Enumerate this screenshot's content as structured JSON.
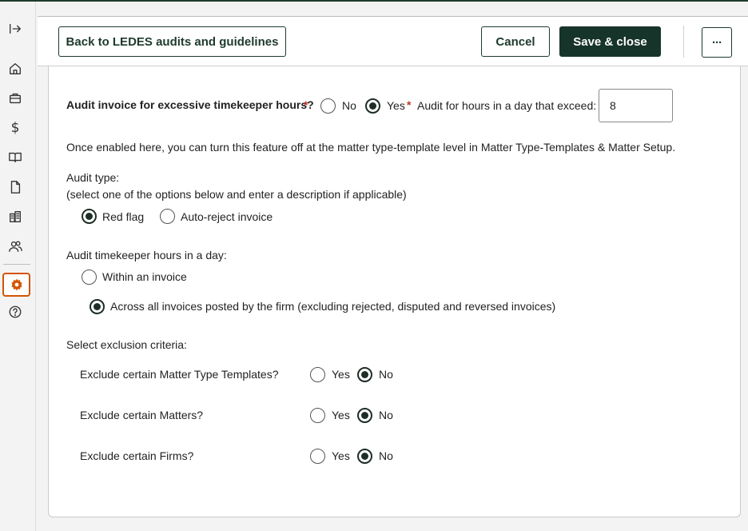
{
  "header": {
    "back_label": "Back to LEDES audits and guidelines",
    "cancel_label": "Cancel",
    "save_label": "Save & close",
    "more_label": "···"
  },
  "sidebar": {
    "icons": [
      "expand-icon",
      "home-icon",
      "briefcase-icon",
      "dollar-icon",
      "book-icon",
      "document-icon",
      "building-icon",
      "users-icon",
      "gear-icon",
      "help-icon"
    ],
    "dollar_glyph": "$",
    "active_item": "gear-icon",
    "active_color": "#d35400"
  },
  "form": {
    "excessive_hours": {
      "label": "Audit invoice for excessive timekeeper hours?",
      "required_mark": "*",
      "no_label": "No",
      "yes_label": "Yes",
      "selected": "Yes"
    },
    "hours_threshold": {
      "required_mark": "*",
      "label": "Audit for hours in a day that exceed:",
      "value": "8"
    },
    "info_text": "Once enabled here, you can turn this feature off at the matter type-template level in Matter Type-Templates & Matter Setup.",
    "audit_type": {
      "label": "Audit type:",
      "hint": "(select one of the options below and enter a description if applicable)",
      "options": [
        "Red flag",
        "Auto-reject invoice"
      ],
      "selected": "Red flag"
    },
    "hours_scope": {
      "label": "Audit timekeeper hours in a day:",
      "options": [
        "Within an invoice",
        "Across all invoices posted by the firm (excluding rejected, disputed and reversed invoices)"
      ],
      "selected": "Across all invoices posted by the firm (excluding rejected, disputed and reversed invoices)"
    },
    "exclusion": {
      "label": "Select exclusion criteria:",
      "yes_label": "Yes",
      "no_label": "No",
      "rows": [
        {
          "label": "Exclude certain Matter Type Templates?",
          "selected": "No"
        },
        {
          "label": "Exclude certain Matters?",
          "selected": "No"
        },
        {
          "label": "Exclude certain Firms?",
          "selected": "No"
        }
      ]
    }
  },
  "colors": {
    "brand_dark": "#17342a",
    "required": "#c0392b"
  }
}
